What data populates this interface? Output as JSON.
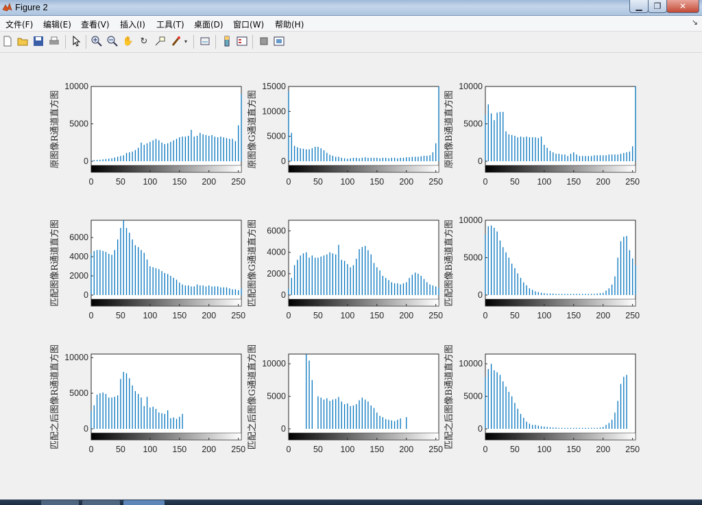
{
  "window": {
    "title": "Figure 2"
  },
  "menu": [
    {
      "label": "文件(F)"
    },
    {
      "label": "编辑(E)"
    },
    {
      "label": "查看(V)"
    },
    {
      "label": "插入(I)"
    },
    {
      "label": "工具(T)"
    },
    {
      "label": "桌面(D)"
    },
    {
      "label": "窗口(W)"
    },
    {
      "label": "帮助(H)"
    }
  ],
  "toolbar": {
    "icons": [
      "new-figure-icon",
      "open-icon",
      "save-icon",
      "print-icon",
      "pointer-icon",
      "zoom-in-icon",
      "zoom-out-icon",
      "pan-icon",
      "rotate-icon",
      "data-cursor-icon",
      "brush-icon",
      "link-icon",
      "colorbar-icon",
      "legend-icon",
      "hide-plot-tools-icon",
      "show-plot-tools-icon"
    ]
  },
  "chart_data": [
    {
      "type": "bar",
      "ylabel": "原图像R通道直方图",
      "xlim": [
        0,
        255
      ],
      "ylim": [
        0,
        10000
      ],
      "yticks": [
        "0",
        "5000",
        "10000"
      ],
      "xticks": [
        "0",
        "50",
        "100",
        "150",
        "200",
        "250"
      ],
      "x": [
        0,
        5,
        10,
        15,
        20,
        25,
        30,
        35,
        40,
        45,
        50,
        55,
        60,
        65,
        70,
        75,
        80,
        85,
        90,
        95,
        100,
        105,
        110,
        115,
        120,
        125,
        130,
        135,
        140,
        145,
        150,
        155,
        160,
        165,
        170,
        175,
        180,
        185,
        190,
        195,
        200,
        205,
        210,
        215,
        220,
        225,
        230,
        235,
        240,
        245,
        250,
        255
      ],
      "values": [
        100,
        150,
        180,
        200,
        250,
        300,
        350,
        400,
        500,
        600,
        700,
        800,
        1100,
        1200,
        1300,
        1500,
        1800,
        2500,
        2200,
        2400,
        2600,
        2800,
        3000,
        2800,
        2500,
        2300,
        2400,
        2600,
        2800,
        3000,
        3200,
        3300,
        3300,
        3400,
        4200,
        3300,
        3400,
        3800,
        3600,
        3500,
        3400,
        3500,
        3300,
        3200,
        3300,
        3200,
        3100,
        3000,
        3000,
        2700,
        4800,
        9000
      ]
    },
    {
      "type": "bar",
      "ylabel": "原图像G通道直方图",
      "xlim": [
        0,
        255
      ],
      "ylim": [
        0,
        15000
      ],
      "yticks": [
        "0",
        "5000",
        "10000",
        "15000"
      ],
      "xticks": [
        "0",
        "50",
        "100",
        "150",
        "200",
        "250"
      ],
      "x": [
        0,
        5,
        10,
        15,
        20,
        25,
        30,
        35,
        40,
        45,
        50,
        55,
        60,
        65,
        70,
        75,
        80,
        85,
        90,
        95,
        100,
        105,
        110,
        115,
        120,
        125,
        130,
        135,
        140,
        145,
        150,
        155,
        160,
        165,
        170,
        175,
        180,
        185,
        190,
        195,
        200,
        205,
        210,
        215,
        220,
        225,
        230,
        235,
        240,
        245,
        250,
        255
      ],
      "values": [
        14000,
        5700,
        3100,
        2800,
        2600,
        2500,
        2400,
        2400,
        2600,
        2900,
        2900,
        2600,
        2200,
        1700,
        1300,
        1100,
        900,
        900,
        700,
        600,
        500,
        600,
        700,
        700,
        600,
        700,
        800,
        700,
        700,
        700,
        700,
        600,
        700,
        700,
        600,
        700,
        700,
        600,
        700,
        700,
        800,
        800,
        900,
        900,
        900,
        1000,
        1100,
        1100,
        1200,
        1800,
        3600,
        15000
      ]
    },
    {
      "type": "bar",
      "ylabel": "原图像B通道直方图",
      "xlim": [
        0,
        255
      ],
      "ylim": [
        0,
        10000
      ],
      "yticks": [
        "0",
        "5000",
        "10000"
      ],
      "xticks": [
        "0",
        "50",
        "100",
        "150",
        "200",
        "250"
      ],
      "x": [
        0,
        5,
        10,
        15,
        20,
        25,
        30,
        35,
        40,
        45,
        50,
        55,
        60,
        65,
        70,
        75,
        80,
        85,
        90,
        95,
        100,
        105,
        110,
        115,
        120,
        125,
        130,
        135,
        140,
        145,
        150,
        155,
        160,
        165,
        170,
        175,
        180,
        185,
        190,
        195,
        200,
        205,
        210,
        215,
        220,
        225,
        230,
        235,
        240,
        245,
        250,
        255
      ],
      "values": [
        6200,
        7600,
        6400,
        5500,
        6500,
        6600,
        6600,
        4000,
        3600,
        3500,
        3400,
        3200,
        3300,
        3200,
        3300,
        3200,
        3200,
        3200,
        3100,
        3300,
        2200,
        1800,
        1400,
        1200,
        1000,
        1000,
        900,
        900,
        700,
        1000,
        1200,
        900,
        700,
        700,
        700,
        700,
        700,
        800,
        800,
        800,
        800,
        800,
        900,
        900,
        900,
        900,
        1000,
        1100,
        1200,
        1300,
        2000,
        10000
      ]
    },
    {
      "type": "bar",
      "ylabel": "匹配图像R通道直方图",
      "xlim": [
        0,
        255
      ],
      "ylim": [
        0,
        7800
      ],
      "yticks": [
        "0",
        "2000",
        "4000",
        "6000"
      ],
      "xticks": [
        "0",
        "50",
        "100",
        "150",
        "200",
        "250"
      ],
      "x": [
        0,
        5,
        10,
        15,
        20,
        25,
        30,
        35,
        40,
        45,
        50,
        55,
        60,
        65,
        70,
        75,
        80,
        85,
        90,
        95,
        100,
        105,
        110,
        115,
        120,
        125,
        130,
        135,
        140,
        145,
        150,
        155,
        160,
        165,
        170,
        175,
        180,
        185,
        190,
        195,
        200,
        205,
        210,
        215,
        220,
        225,
        230,
        235,
        240,
        245,
        250,
        255
      ],
      "values": [
        4300,
        4600,
        4700,
        4700,
        4600,
        4500,
        4300,
        4200,
        4700,
        5800,
        7000,
        7800,
        7000,
        6500,
        5800,
        5200,
        5000,
        4700,
        4400,
        3700,
        3000,
        2900,
        2800,
        2700,
        2500,
        2300,
        2200,
        2000,
        1800,
        1600,
        1300,
        1100,
        1000,
        1000,
        900,
        900,
        1100,
        1000,
        1000,
        900,
        1000,
        900,
        900,
        900,
        800,
        800,
        800,
        700,
        600,
        600,
        500,
        700
      ]
    },
    {
      "type": "bar",
      "ylabel": "匹配图像G通道直方图",
      "xlim": [
        0,
        255
      ],
      "ylim": [
        0,
        7000
      ],
      "yticks": [
        "0",
        "2000",
        "4000",
        "6000"
      ],
      "xticks": [
        "0",
        "50",
        "100",
        "150",
        "200",
        "250"
      ],
      "x": [
        0,
        5,
        10,
        15,
        20,
        25,
        30,
        35,
        40,
        45,
        50,
        55,
        60,
        65,
        70,
        75,
        80,
        85,
        90,
        95,
        100,
        105,
        110,
        115,
        120,
        125,
        130,
        135,
        140,
        145,
        150,
        155,
        160,
        165,
        170,
        175,
        180,
        185,
        190,
        195,
        200,
        205,
        210,
        215,
        220,
        225,
        230,
        235,
        240,
        245,
        250,
        255
      ],
      "values": [
        600,
        1600,
        2800,
        3300,
        3700,
        3900,
        4000,
        3500,
        3700,
        3500,
        3500,
        3600,
        3700,
        3800,
        4000,
        3900,
        3800,
        4700,
        3300,
        3200,
        2900,
        2600,
        2800,
        3400,
        4300,
        4500,
        4600,
        4200,
        3800,
        3000,
        2600,
        2300,
        1800,
        1600,
        1400,
        1200,
        1100,
        1100,
        1000,
        1100,
        1200,
        1600,
        1900,
        2100,
        2000,
        1800,
        1500,
        1200,
        1000,
        900,
        800,
        700
      ]
    },
    {
      "type": "bar",
      "ylabel": "匹配图像B通道直方图",
      "xlim": [
        0,
        255
      ],
      "ylim": [
        0,
        10000
      ],
      "yticks": [
        "0",
        "5000",
        "10000"
      ],
      "xticks": [
        "0",
        "50",
        "100",
        "150",
        "200",
        "250"
      ],
      "x": [
        0,
        5,
        10,
        15,
        20,
        25,
        30,
        35,
        40,
        45,
        50,
        55,
        60,
        65,
        70,
        75,
        80,
        85,
        90,
        95,
        100,
        105,
        110,
        115,
        120,
        125,
        130,
        135,
        140,
        145,
        150,
        155,
        160,
        165,
        170,
        175,
        180,
        185,
        190,
        195,
        200,
        205,
        210,
        215,
        220,
        225,
        230,
        235,
        240,
        245,
        250,
        255
      ],
      "values": [
        8100,
        9200,
        9300,
        9000,
        8500,
        7300,
        6400,
        5700,
        5000,
        4200,
        3600,
        2900,
        2300,
        1700,
        1300,
        900,
        700,
        500,
        400,
        300,
        250,
        200,
        200,
        200,
        150,
        150,
        150,
        150,
        150,
        150,
        150,
        150,
        150,
        150,
        150,
        150,
        150,
        150,
        200,
        250,
        300,
        600,
        900,
        1400,
        2500,
        5000,
        7200,
        7800,
        7900,
        6000,
        4900,
        4000
      ]
    },
    {
      "type": "bar",
      "ylabel": "匹配之后图像R通道直方图",
      "xlim": [
        0,
        255
      ],
      "ylim": [
        0,
        10500
      ],
      "yticks": [
        "0",
        "5000",
        "10000"
      ],
      "xticks": [
        "0",
        "50",
        "100",
        "150",
        "200",
        "250"
      ],
      "x": [
        0,
        5,
        10,
        15,
        20,
        25,
        30,
        35,
        40,
        45,
        50,
        55,
        60,
        65,
        70,
        75,
        80,
        85,
        90,
        95,
        100,
        105,
        110,
        115,
        120,
        125,
        130,
        135,
        140,
        145,
        150,
        155
      ],
      "values": [
        2500,
        3300,
        4800,
        5000,
        5100,
        4900,
        4400,
        4400,
        4500,
        4700,
        7000,
        8000,
        7800,
        7100,
        6100,
        5300,
        4900,
        4400,
        3200,
        4500,
        3000,
        3100,
        2800,
        2300,
        2200,
        2100,
        2600,
        1500,
        1600,
        1400,
        1700,
        2100
      ]
    },
    {
      "type": "bar",
      "ylabel": "匹配之后图像G通道直方图",
      "xlim": [
        0,
        255
      ],
      "ylim": [
        0,
        11500
      ],
      "yticks": [
        "0",
        "5000",
        "10000"
      ],
      "xticks": [
        "0",
        "50",
        "100",
        "150",
        "200",
        "250"
      ],
      "x": [
        30,
        35,
        40,
        50,
        55,
        60,
        65,
        70,
        75,
        80,
        85,
        90,
        95,
        100,
        105,
        110,
        115,
        120,
        125,
        130,
        135,
        140,
        145,
        150,
        155,
        160,
        165,
        170,
        175,
        180,
        185,
        190,
        200
      ],
      "values": [
        11500,
        10500,
        7500,
        5000,
        4800,
        4500,
        4700,
        4300,
        4500,
        4600,
        4900,
        4200,
        3800,
        3900,
        3500,
        3600,
        3800,
        4400,
        4800,
        4500,
        4200,
        3600,
        3200,
        2500,
        2000,
        1800,
        1500,
        1400,
        1300,
        1200,
        1400,
        1600,
        1800
      ]
    },
    {
      "type": "bar",
      "ylabel": "匹配之后图像B通道直方图",
      "xlim": [
        0,
        255
      ],
      "ylim": [
        0,
        11500
      ],
      "yticks": [
        "0",
        "5000",
        "10000"
      ],
      "xticks": [
        "0",
        "50",
        "100",
        "150",
        "200",
        "250"
      ],
      "x": [
        0,
        5,
        10,
        15,
        20,
        25,
        30,
        35,
        40,
        45,
        50,
        55,
        60,
        65,
        70,
        75,
        80,
        85,
        90,
        95,
        100,
        105,
        110,
        115,
        120,
        125,
        130,
        135,
        140,
        145,
        150,
        155,
        160,
        165,
        170,
        175,
        180,
        185,
        190,
        195,
        200,
        205,
        210,
        215,
        220,
        225,
        230,
        235,
        240
      ],
      "values": [
        8000,
        9200,
        10000,
        9000,
        8700,
        8300,
        7300,
        6500,
        5700,
        5000,
        4000,
        3100,
        2300,
        1700,
        1100,
        800,
        600,
        600,
        500,
        400,
        350,
        300,
        250,
        200,
        200,
        150,
        150,
        150,
        150,
        150,
        150,
        150,
        150,
        150,
        150,
        150,
        150,
        150,
        150,
        200,
        300,
        600,
        900,
        1400,
        2500,
        4300,
        6900,
        8000,
        8300
      ]
    }
  ]
}
